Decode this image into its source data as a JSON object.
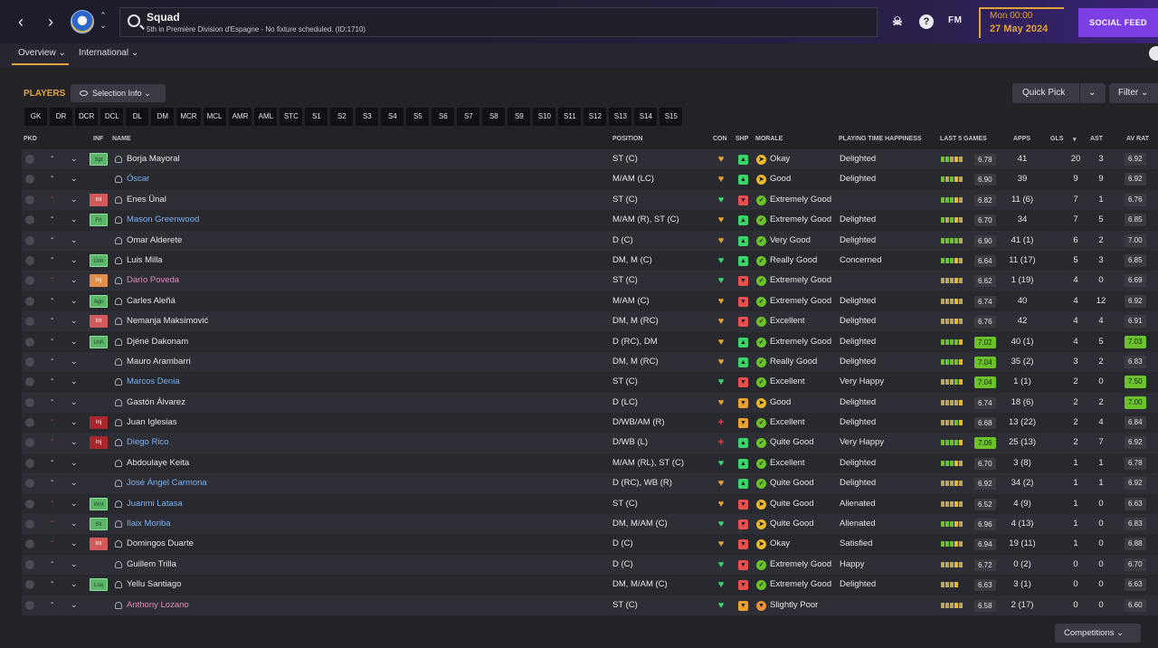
{
  "topbar": {
    "title": "Squad",
    "subtitle": "5th in Première Division d'Espagne - No fixture scheduled. (ID:1710)",
    "fm_logo": "FM",
    "date_time": "Mon 00:00",
    "date_day": "27 May 2024",
    "social_feed": "SOCIAL FEED"
  },
  "subnav": {
    "tabs": [
      "Overview",
      "International"
    ]
  },
  "players_header": {
    "label": "PLAYERS",
    "selection_info": "Selection Info",
    "quick_pick": "Quick Pick",
    "filter": "Filter"
  },
  "position_filters": [
    "GK",
    "DR",
    "DCR",
    "DCL",
    "DL",
    "DM",
    "MCR",
    "MCL",
    "AMR",
    "AML",
    "STC",
    "S1",
    "S2",
    "S3",
    "S4",
    "S5",
    "S6",
    "S7",
    "S8",
    "S9",
    "S10",
    "S11",
    "S12",
    "S13",
    "S14",
    "S15"
  ],
  "columns": {
    "pkd": "PKD",
    "inf": "INF",
    "name": "NAME",
    "position": "POSITION",
    "con": "CON",
    "shp": "SHP",
    "morale": "MORALE",
    "pth": "PLAYING TIME HAPPINESS",
    "last5": "LAST 5 GAMES",
    "apps": "APPS",
    "gls": "GLS",
    "sort": "▾",
    "ast": "AST",
    "avrat": "AV RAT"
  },
  "rows": [
    {
      "dash_red": false,
      "inf": "Spt",
      "inf_color": "green",
      "name": "Borja Mayoral",
      "name_color": "white",
      "position": "ST (C)",
      "con": "amber",
      "shp": "up",
      "morale_icon": "dir",
      "morale": "Okay",
      "pth": "Delighted",
      "form": "ggoao",
      "form_rating": "6.78",
      "form_good": false,
      "apps": "41",
      "gls": "20",
      "ast": "3",
      "avrat": "6.92",
      "av_good": false
    },
    {
      "dash_red": false,
      "inf": "",
      "inf_color": "",
      "name": "Óscar",
      "name_color": "blue",
      "position": "M/AM (LC)",
      "con": "amber",
      "shp": "up",
      "morale_icon": "dir",
      "morale": "Good",
      "pth": "Delighted",
      "form": "gogao",
      "form_rating": "6.90",
      "form_good": false,
      "apps": "39",
      "gls": "9",
      "ast": "9",
      "avrat": "6.92",
      "av_good": false
    },
    {
      "dash_red": true,
      "inf": "Int",
      "inf_color": "red",
      "name": "Enes Ünal",
      "name_color": "white",
      "position": "ST (C)",
      "con": "green",
      "shp": "down",
      "morale_icon": "check",
      "morale": "Extremely Good",
      "pth": "",
      "form": "gggao",
      "form_rating": "6.82",
      "form_good": false,
      "apps": "11 (6)",
      "gls": "7",
      "ast": "1",
      "avrat": "6.76",
      "av_good": false
    },
    {
      "dash_red": false,
      "inf": "Frt",
      "inf_color": "green",
      "name": "Mason Greenwood",
      "name_color": "blue",
      "position": "M/AM (R), ST (C)",
      "con": "amber",
      "shp": "up",
      "morale_icon": "check",
      "morale": "Extremely Good",
      "pth": "Delighted",
      "form": "gogao",
      "form_rating": "6.70",
      "form_good": false,
      "apps": "34",
      "gls": "7",
      "ast": "5",
      "avrat": "6.85",
      "av_good": false
    },
    {
      "dash_red": false,
      "inf": "",
      "inf_color": "",
      "name": "Omar Alderete",
      "name_color": "white",
      "position": "D (C)",
      "con": "amber",
      "shp": "up",
      "morale_icon": "check",
      "morale": "Very Good",
      "pth": "Delighted",
      "form": "ggggo",
      "form_rating": "6.90",
      "form_good": false,
      "apps": "41 (1)",
      "gls": "6",
      "ast": "2",
      "avrat": "7.00",
      "av_good": false
    },
    {
      "dash_red": false,
      "inf": "Unh",
      "inf_color": "green",
      "name": "Luis Milla",
      "name_color": "white",
      "position": "DM, M (C)",
      "con": "green",
      "shp": "up",
      "morale_icon": "check",
      "morale": "Really Good",
      "pth": "Concerned",
      "form": "gggao",
      "form_rating": "6.64",
      "form_good": false,
      "apps": "11 (17)",
      "gls": "5",
      "ast": "3",
      "avrat": "6.85",
      "av_good": false
    },
    {
      "dash_red": true,
      "inf": "Inj",
      "inf_color": "orange",
      "name": "Darío Poveda",
      "name_color": "pink",
      "position": "ST (C)",
      "con": "green",
      "shp": "down",
      "morale_icon": "check",
      "morale": "Extremely Good",
      "pth": "",
      "form": "oooao",
      "form_rating": "6.62",
      "form_good": false,
      "apps": "1 (19)",
      "gls": "4",
      "ast": "0",
      "avrat": "6.69",
      "av_good": false
    },
    {
      "dash_red": false,
      "inf": "Agn",
      "inf_color": "green",
      "name": "Carles Aleñá",
      "name_color": "white",
      "position": "M/AM (C)",
      "con": "amber",
      "shp": "down",
      "morale_icon": "check",
      "morale": "Extremely Good",
      "pth": "Delighted",
      "form": "oooao",
      "form_rating": "6.74",
      "form_good": false,
      "apps": "40",
      "gls": "4",
      "ast": "12",
      "avrat": "6.92",
      "av_good": false
    },
    {
      "dash_red": false,
      "inf": "Int",
      "inf_color": "red",
      "name": "Nemanja Maksimović",
      "name_color": "white",
      "position": "DM, M (RC)",
      "con": "amber",
      "shp": "down",
      "morale_icon": "check",
      "morale": "Excellent",
      "pth": "Delighted",
      "form": "oooao",
      "form_rating": "6.76",
      "form_good": false,
      "apps": "42",
      "gls": "4",
      "ast": "4",
      "avrat": "6.91",
      "av_good": false
    },
    {
      "dash_red": false,
      "inf": "Unh",
      "inf_color": "green",
      "name": "Djéné Dakonam",
      "name_color": "white",
      "position": "D (RC), DM",
      "con": "amber",
      "shp": "up",
      "morale_icon": "check",
      "morale": "Extremely Good",
      "pth": "Delighted",
      "form": "gggga",
      "form_rating": "7.02",
      "form_good": true,
      "apps": "40 (1)",
      "gls": "4",
      "ast": "5",
      "avrat": "7.03",
      "av_good": true
    },
    {
      "dash_red": false,
      "inf": "",
      "inf_color": "",
      "name": "Mauro Arambarri",
      "name_color": "white",
      "position": "DM, M (RC)",
      "con": "amber",
      "shp": "up",
      "morale_icon": "check",
      "morale": "Really Good",
      "pth": "Delighted",
      "form": "gggga",
      "form_rating": "7.04",
      "form_good": true,
      "apps": "35 (2)",
      "gls": "3",
      "ast": "2",
      "avrat": "6.83",
      "av_good": false
    },
    {
      "dash_red": false,
      "inf": "",
      "inf_color": "",
      "name": "Marcos Denia",
      "name_color": "blue",
      "position": "ST (C)",
      "con": "green",
      "shp": "down",
      "morale_icon": "check",
      "morale": "Excellent",
      "pth": "Very Happy",
      "form": "oooga",
      "form_rating": "7.04",
      "form_good": true,
      "apps": "1 (1)",
      "gls": "2",
      "ast": "0",
      "avrat": "7.50",
      "av_good": true
    },
    {
      "dash_red": false,
      "inf": "",
      "inf_color": "",
      "name": "Gastón Álvarez",
      "name_color": "white",
      "position": "D (LC)",
      "con": "amber",
      "shp": "warn",
      "morale_icon": "dir",
      "morale": "Good",
      "pth": "Delighted",
      "form": "ooooa",
      "form_rating": "6.74",
      "form_good": false,
      "apps": "18 (6)",
      "gls": "2",
      "ast": "2",
      "avrat": "7.00",
      "av_good": true
    },
    {
      "dash_red": true,
      "inf": "Inj",
      "inf_color": "darkred",
      "name": "Juan Iglesias",
      "name_color": "white",
      "position": "D/WB/AM (R)",
      "con": "red",
      "shp": "warn",
      "morale_icon": "check",
      "morale": "Excellent",
      "pth": "Delighted",
      "form": "oooga",
      "form_rating": "6.68",
      "form_good": false,
      "apps": "13 (22)",
      "gls": "2",
      "ast": "4",
      "avrat": "6.84",
      "av_good": false
    },
    {
      "dash_red": true,
      "inf": "Inj",
      "inf_color": "darkred",
      "name": "Diego Rico",
      "name_color": "blue",
      "position": "D/WB (L)",
      "con": "red",
      "shp": "up",
      "morale_icon": "check",
      "morale": "Quite Good",
      "pth": "Very Happy",
      "form": "gggga",
      "form_rating": "7.06",
      "form_good": true,
      "apps": "25 (13)",
      "gls": "2",
      "ast": "7",
      "avrat": "6.92",
      "av_good": false
    },
    {
      "dash_red": false,
      "inf": "",
      "inf_color": "",
      "name": "Abdoulaye Keita",
      "name_color": "white",
      "position": "M/AM (RL), ST (C)",
      "con": "green",
      "shp": "up",
      "morale_icon": "check",
      "morale": "Excellent",
      "pth": "Delighted",
      "form": "gggao",
      "form_rating": "6.70",
      "form_good": false,
      "apps": "3 (8)",
      "gls": "1",
      "ast": "1",
      "avrat": "6.78",
      "av_good": false
    },
    {
      "dash_red": false,
      "inf": "",
      "inf_color": "",
      "name": "José Ángel Carmona",
      "name_color": "blue",
      "position": "D (RC), WB (R)",
      "con": "amber",
      "shp": "up",
      "morale_icon": "check",
      "morale": "Quite Good",
      "pth": "Delighted",
      "form": "oooao",
      "form_rating": "6.92",
      "form_good": false,
      "apps": "34 (2)",
      "gls": "1",
      "ast": "1",
      "avrat": "6.92",
      "av_good": false
    },
    {
      "dash_red": true,
      "inf": "Wnt",
      "inf_color": "green",
      "name": "Juanmi Latasa",
      "name_color": "blue",
      "position": "ST (C)",
      "con": "amber",
      "shp": "down",
      "morale_icon": "dir",
      "morale": "Quite Good",
      "pth": "Alienated",
      "form": "oooao",
      "form_rating": "6.52",
      "form_good": false,
      "apps": "4 (9)",
      "gls": "1",
      "ast": "0",
      "avrat": "6.63",
      "av_good": false
    },
    {
      "dash_red": true,
      "inf": "Slt",
      "inf_color": "green",
      "name": "Ilaix Moriba",
      "name_color": "blue",
      "position": "DM, M/AM (C)",
      "con": "green",
      "shp": "down",
      "morale_icon": "dir",
      "morale": "Quite Good",
      "pth": "Alienated",
      "form": "gggao",
      "form_rating": "6.96",
      "form_good": false,
      "apps": "4 (13)",
      "gls": "1",
      "ast": "0",
      "avrat": "6.83",
      "av_good": false
    },
    {
      "dash_red": true,
      "inf": "Int",
      "inf_color": "red",
      "name": "Domingos Duarte",
      "name_color": "white",
      "position": "D (C)",
      "con": "amber",
      "shp": "down",
      "morale_icon": "dir",
      "morale": "Okay",
      "pth": "Satisfied",
      "form": "gggao",
      "form_rating": "6.94",
      "form_good": false,
      "apps": "19 (11)",
      "gls": "1",
      "ast": "0",
      "avrat": "6.88",
      "av_good": false
    },
    {
      "dash_red": false,
      "inf": "",
      "inf_color": "",
      "name": "Guillem Trilla",
      "name_color": "white",
      "position": "D (C)",
      "con": "green",
      "shp": "down",
      "morale_icon": "check",
      "morale": "Extremely Good",
      "pth": "Happy",
      "form": "oooao",
      "form_rating": "6.72",
      "form_good": false,
      "apps": "0 (2)",
      "gls": "0",
      "ast": "0",
      "avrat": "6.70",
      "av_good": false
    },
    {
      "dash_red": false,
      "inf": "Loa",
      "inf_color": "green",
      "name": "Yellu Santiago",
      "name_color": "white",
      "position": "DM, M/AM (C)",
      "con": "green",
      "shp": "down",
      "morale_icon": "check",
      "morale": "Extremely Good",
      "pth": "Delighted",
      "form": "oooa",
      "form_rating": "6.63",
      "form_good": false,
      "apps": "3 (1)",
      "gls": "0",
      "ast": "0",
      "avrat": "6.63",
      "av_good": false
    },
    {
      "dash_red": false,
      "inf": "",
      "inf_color": "",
      "name": "Anthony Lozano",
      "name_color": "pink",
      "position": "ST (C)",
      "con": "green",
      "shp": "warn",
      "morale_icon": "poor",
      "morale": "Slightly Poor",
      "pth": "",
      "form": "oooao",
      "form_rating": "6.58",
      "form_good": false,
      "apps": "2 (17)",
      "gls": "0",
      "ast": "0",
      "avrat": "6.60",
      "av_good": false
    }
  ],
  "competitions": "Competitions",
  "colors": {
    "accent": "#e0a43a",
    "social": "#7b3fe4",
    "form_green": "#6cc22a",
    "form_olive": "#b8a860",
    "con_green": "#3ad46a",
    "con_amber": "#e8a030",
    "con_red": "#d83a3a",
    "shp_up": "#3ad46a",
    "shp_down": "#e85050",
    "shp_warn": "#e8a030",
    "morale_dir": "#e8b830",
    "morale_check": "#6cc22a",
    "morale_poor": "#e8903a"
  }
}
